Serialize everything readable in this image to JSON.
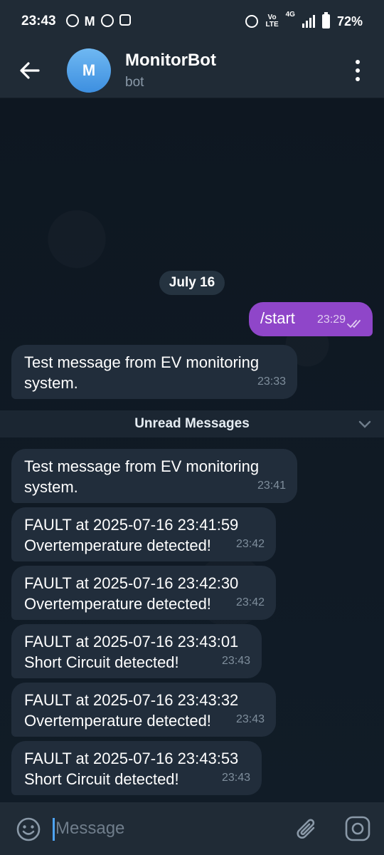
{
  "status_bar": {
    "time": "23:43",
    "volte_top": "Vo",
    "volte_bottom": "LTE",
    "network": "4G",
    "battery": "72%"
  },
  "header": {
    "avatar_letter": "M",
    "title": "MonitorBot",
    "subtitle": "bot"
  },
  "chat": {
    "date_label": "July 16",
    "outgoing": {
      "text": "/start",
      "time": "23:29"
    },
    "before_unread": [
      {
        "text": "Test message from EV monitoring\nsystem.",
        "time": "23:33"
      }
    ],
    "unread_label": "Unread Messages",
    "messages": [
      {
        "text": "Test message from EV monitoring\nsystem.",
        "time": "23:41"
      },
      {
        "text": "FAULT at 2025-07-16 23:41:59\nOvertemperature detected!",
        "time": "23:42"
      },
      {
        "text": "FAULT at 2025-07-16 23:42:30\nOvertemperature detected!",
        "time": "23:42"
      },
      {
        "text": "FAULT at 2025-07-16 23:43:01\nShort Circuit detected!",
        "time": "23:43"
      },
      {
        "text": "FAULT at 2025-07-16 23:43:32\nOvertemperature detected!",
        "time": "23:43"
      },
      {
        "text": "FAULT at 2025-07-16 23:43:53\nShort Circuit detected!",
        "time": "23:43"
      }
    ]
  },
  "input": {
    "placeholder": "Message"
  },
  "colors": {
    "header_bg": "#202b36",
    "incoming_bubble": "#212d3b",
    "outgoing_bubble": "#8f46c9",
    "avatar": "#4a9be6",
    "caret": "#4ea4f6"
  },
  "icons": [
    "back-arrow-icon",
    "more-vert-icon",
    "double-check-icon",
    "chevron-down-icon",
    "emoji-icon",
    "attach-icon",
    "camera-icon"
  ]
}
